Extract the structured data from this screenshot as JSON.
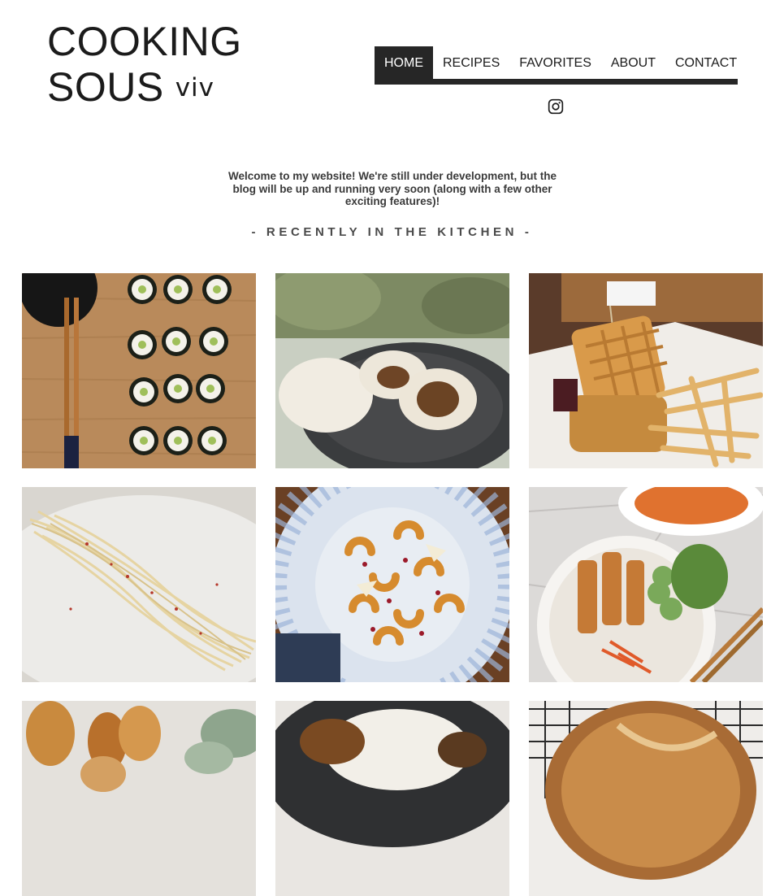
{
  "logo": {
    "line1": "COOKING",
    "line2": "SOUS",
    "script": "viv"
  },
  "nav": {
    "items": [
      {
        "label": "HOME",
        "active": true
      },
      {
        "label": "RECIPES",
        "active": false
      },
      {
        "label": "FAVORITES",
        "active": false
      },
      {
        "label": "ABOUT",
        "active": false
      },
      {
        "label": "CONTACT",
        "active": false
      }
    ]
  },
  "social": {
    "icon": "instagram-icon"
  },
  "welcome": {
    "text": "Welcome to my website! We're still under development, but the blog will be up and running very soon (along with a few other exciting features)!"
  },
  "section": {
    "title": "- RECENTLY IN THE KITCHEN -"
  },
  "gallery": {
    "photos": [
      {
        "subject": "sushi rolls with chopsticks"
      },
      {
        "subject": "steamed buns"
      },
      {
        "subject": "chicken and waffles with fries"
      },
      {
        "subject": "spaghetti with chili flakes"
      },
      {
        "subject": "roasted delicata squash salad"
      },
      {
        "subject": "spring roll vermicelli bowl"
      },
      {
        "subject": "madeleines"
      },
      {
        "subject": "bao buns"
      },
      {
        "subject": "sourdough bread"
      }
    ]
  },
  "colors": {
    "text": "#1b1b1b",
    "navActive": "#262626",
    "welcome": "#3a3a3a"
  }
}
